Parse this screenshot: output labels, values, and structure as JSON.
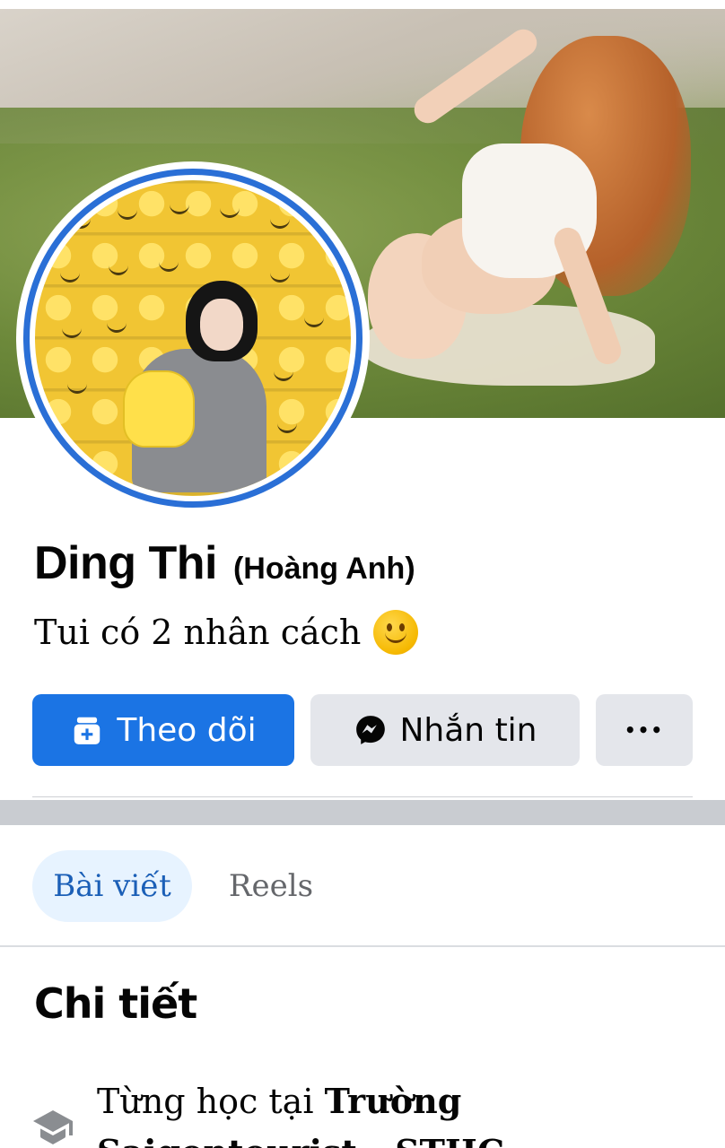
{
  "profile": {
    "name": "Ding Thi",
    "alternate_name": "(Hoàng Anh)",
    "bio": "Tui có 2 nhân cách",
    "bio_emoji": "slightly-smiling-face"
  },
  "actions": {
    "follow_label": "Theo dõi",
    "message_label": "Nhắn tin",
    "more_label": "•••"
  },
  "tabs": [
    {
      "label": "Bài viết",
      "active": true
    },
    {
      "label": "Reels",
      "active": false
    }
  ],
  "details": {
    "title": "Chi tiết",
    "education": {
      "prefix": "Từng học tại ",
      "school_part1": "Trường",
      "school_part2": "Saigontourist - STHC",
      "icon": "graduation-cap-icon"
    }
  },
  "colors": {
    "primary": "#1b74e4",
    "secondary_button": "#e4e6eb",
    "active_tab_bg": "#e7f3ff",
    "active_tab_text": "#1b5fb7",
    "avatar_ring": "#2a6fd6"
  }
}
